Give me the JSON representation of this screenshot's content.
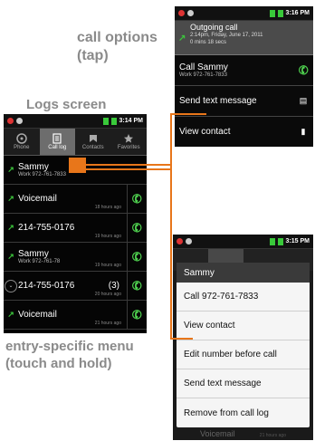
{
  "captions": {
    "call_options": "call options (tap)",
    "logs_screen": "Logs screen",
    "entry_menu": "entry-specific menu (touch and hold)"
  },
  "status_bar": {
    "logs_time": "3:14 PM",
    "options_time": "3:16 PM",
    "menu_time": "3:15 PM"
  },
  "logs": {
    "tabs": [
      {
        "label": "Phone",
        "icon": "phone-dial-icon"
      },
      {
        "label": "Call log",
        "icon": "call-log-icon"
      },
      {
        "label": "Contacts",
        "icon": "contacts-icon"
      },
      {
        "label": "Favorites",
        "icon": "star-icon"
      }
    ],
    "entries": [
      {
        "name": "Sammy",
        "detail": "Work 972-761-7833",
        "time": "",
        "count": ""
      },
      {
        "name": "Voicemail",
        "detail": "",
        "time": "18 hours ago",
        "count": ""
      },
      {
        "name": "214-755-0176",
        "detail": "",
        "time": "19 hours ago",
        "count": ""
      },
      {
        "name": "Sammy",
        "detail": "Work 972-761-78",
        "time": "19 hours ago",
        "count": ""
      },
      {
        "name": "214-755-0176",
        "detail": "",
        "time": "20 hours ago",
        "count": "(3)"
      },
      {
        "name": "Voicemail",
        "detail": "",
        "time": "21 hours ago",
        "count": ""
      }
    ]
  },
  "options": {
    "header_title": "Outgoing call",
    "header_line1": "2:14pm, Friday, June 17, 2011",
    "header_line2": "0 mins 18 secs",
    "items": [
      {
        "label": "Call Sammy",
        "sub": "Work 972-761-7833"
      },
      {
        "label": "Send text message",
        "sub": ""
      },
      {
        "label": "View contact",
        "sub": ""
      }
    ]
  },
  "menu": {
    "title": "Sammy",
    "items": [
      "Call 972-761-7833",
      "View contact",
      "Edit number before call",
      "Send text message",
      "Remove from call log"
    ],
    "behind_text": "Voicemail",
    "behind_time": "21 hours ago"
  },
  "colors": {
    "accent": "#e8761a",
    "call_green": "#4fd24f",
    "caption_gray": "#8a8a8a"
  }
}
